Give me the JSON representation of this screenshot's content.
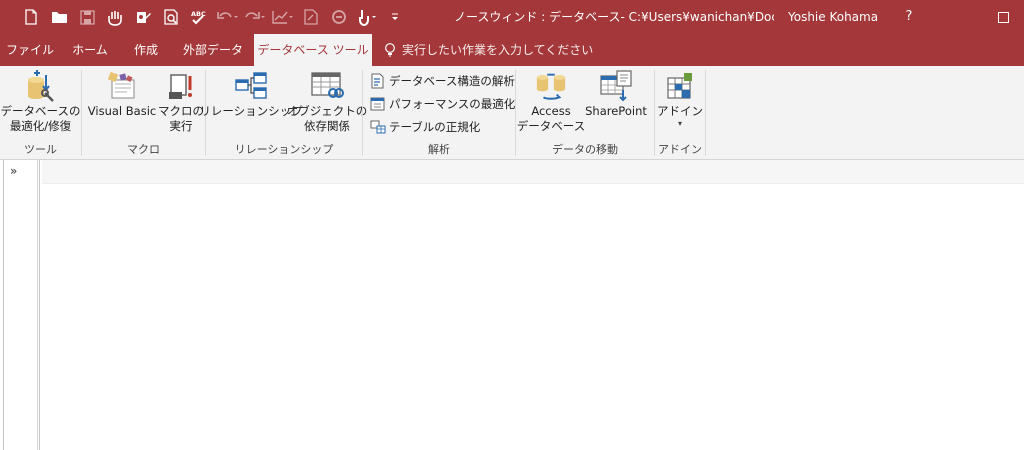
{
  "window": {
    "title": "ノースウィンド : データベース- C:¥Users¥wanichan¥Docum…",
    "user": "Yoshie Kohama",
    "help": "?"
  },
  "tabs": [
    {
      "label": "ファイル"
    },
    {
      "label": "ホーム"
    },
    {
      "label": "作成"
    },
    {
      "label": "外部データ"
    },
    {
      "label": "データベース ツール"
    }
  ],
  "active_tab": "データベース ツール",
  "tell_me": "実行したい作業を入力してください",
  "ribbon": {
    "tools": {
      "label": "ツール",
      "compact_repair": [
        "データベースの",
        "最適化/修復"
      ]
    },
    "macro": {
      "label": "マクロ",
      "visual_basic": "Visual Basic",
      "run_macro": [
        "マクロの",
        "実行"
      ]
    },
    "relationships": {
      "label": "リレーションシップ",
      "relationships": "リレーションシップ",
      "object_dependencies": [
        "オブジェクトの",
        "依存関係"
      ]
    },
    "analyze": {
      "label": "解析",
      "documenter": "データベース構造の解析",
      "performance": "パフォーマンスの最適化",
      "table": "テーブルの正規化"
    },
    "move_data": {
      "label": "データの移動",
      "access": [
        "Access",
        "データベース"
      ],
      "sharepoint": "SharePoint"
    },
    "addins": {
      "label": "アドイン",
      "addins": "アドイン"
    }
  },
  "nav_pane": {
    "toggle": "»"
  }
}
